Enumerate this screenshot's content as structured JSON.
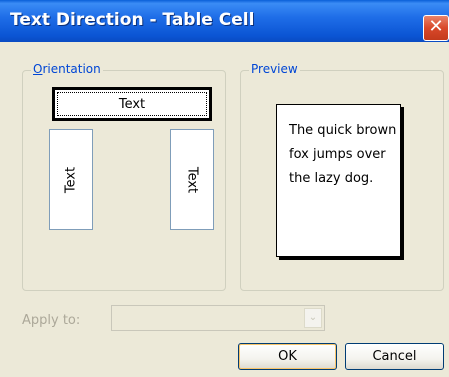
{
  "window": {
    "title": "Text Direction - Table Cell",
    "close_glyph": "✕"
  },
  "orientation": {
    "label_accel": "O",
    "label_rest": "rientation",
    "options": [
      {
        "label": "Text",
        "direction": "horizontal",
        "selected": true
      },
      {
        "label": "Text",
        "direction": "vertical-up",
        "selected": false
      },
      {
        "label": "Text",
        "direction": "vertical-down",
        "selected": false
      }
    ]
  },
  "preview": {
    "label": "Preview",
    "lines": [
      "The quick brown",
      "fox jumps over",
      "the lazy dog."
    ]
  },
  "apply_to": {
    "label": "Apply to:",
    "value": "",
    "disabled": true,
    "arrow_glyph": "⌄"
  },
  "buttons": {
    "ok": "OK",
    "cancel": "Cancel"
  },
  "colors": {
    "titlebar": "#0a55d4",
    "dialog_bg": "#ece9d8",
    "group_label": "#0046d5",
    "close": "#d9482a"
  }
}
